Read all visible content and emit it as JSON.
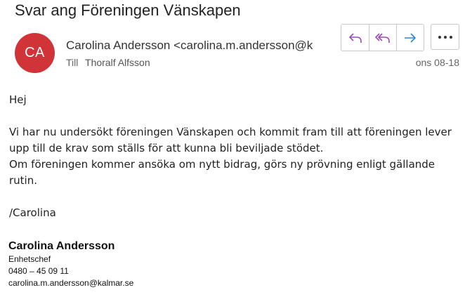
{
  "email": {
    "subject": "Svar ang Föreningen Vänskapen",
    "avatar_initials": "CA",
    "avatar_color": "#d13438",
    "sender": "Carolina Andersson <carolina.m.andersson@k",
    "to_label": "Till",
    "to_name": "Thoralf Alfsson",
    "date": "ons 08-18",
    "actions": {
      "reply_icon": "reply-icon",
      "reply_all_icon": "reply-all-icon",
      "forward_icon": "forward-icon",
      "more_icon": "more-options-icon"
    },
    "body": {
      "greeting": "Hej",
      "paragraph1_line1": "Vi har nu undersökt föreningen Vänskapen och kommit fram till att föreningen lever",
      "paragraph1_line2": "upp till de krav som ställs för att kunna bli beviljade stödet.",
      "paragraph1_line3": "Om föreningen kommer ansöka om nytt bidrag,  görs ny prövning enligt gällande",
      "paragraph1_line4": "rutin.",
      "closing": "/Carolina"
    },
    "signature": {
      "name": "Carolina Andersson",
      "title": "Enhetschef",
      "phone": "0480 – 45 09 11",
      "email": "carolina.m.andersson@kalmar.se"
    }
  }
}
